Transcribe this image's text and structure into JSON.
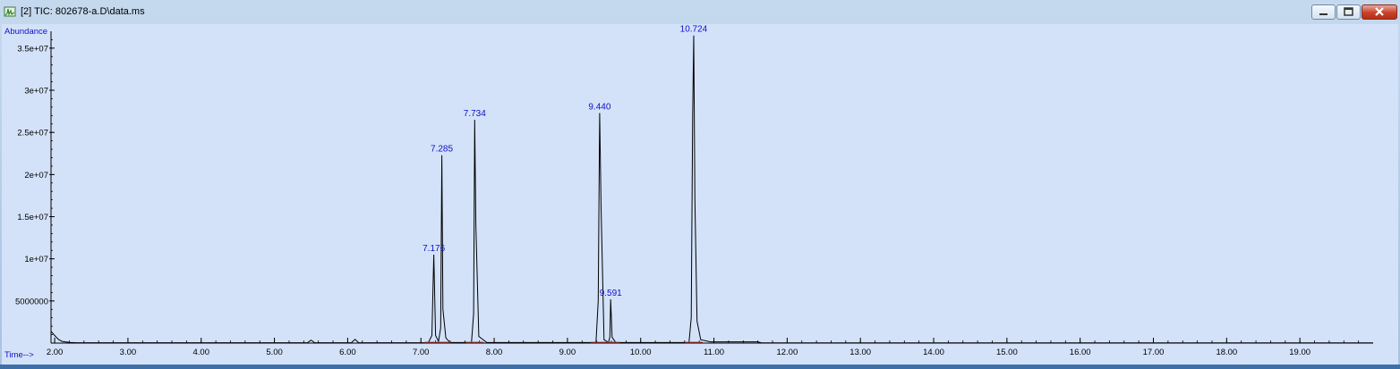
{
  "window": {
    "title": "[2] TIC: 802678-a.D\\data.ms",
    "icon": "chromatogram-app-icon",
    "controls": [
      "minimize-icon",
      "maximize-icon",
      "close-icon"
    ],
    "colors": {
      "plot_bg": "#d3e2f9",
      "trace": "#000000",
      "peak_label": "#1010c8",
      "baseline_marks": "#d04040"
    }
  },
  "chart_data": {
    "type": "line",
    "title": "",
    "ylabel": "Abundance",
    "xlabel": "Time-->",
    "xlim": [
      1.95,
      20.0
    ],
    "ylim": [
      0,
      37000000
    ],
    "x_ticks": [
      "2.00",
      "3.00",
      "4.00",
      "5.00",
      "6.00",
      "7.00",
      "8.00",
      "9.00",
      "10.00",
      "11.00",
      "12.00",
      "13.00",
      "14.00",
      "15.00",
      "16.00",
      "17.00",
      "18.00",
      "19.00"
    ],
    "y_ticks": [
      "5000000",
      "1e+07",
      "1.5e+07",
      "2e+07",
      "2.5e+07",
      "3e+07",
      "3.5e+07"
    ],
    "grid": false,
    "peaks": [
      {
        "rt": 7.176,
        "label": "7.176",
        "abundance": 10500000
      },
      {
        "rt": 7.285,
        "label": "7.285",
        "abundance": 22300000
      },
      {
        "rt": 7.734,
        "label": "7.734",
        "abundance": 26500000
      },
      {
        "rt": 9.44,
        "label": "9.440",
        "abundance": 27300000
      },
      {
        "rt": 9.591,
        "label": "9.591",
        "abundance": 5200000
      },
      {
        "rt": 10.724,
        "label": "10.724",
        "abundance": 36500000
      }
    ],
    "series": [
      {
        "x": [
          1.95,
          2.0,
          2.05,
          2.1,
          2.2,
          2.3,
          5.45,
          5.5,
          5.55,
          6.05,
          6.1,
          6.15,
          7.1,
          7.15,
          7.176,
          7.2,
          7.24,
          7.27,
          7.285,
          7.3,
          7.34,
          7.4,
          7.69,
          7.72,
          7.734,
          7.75,
          7.79,
          7.9,
          9.39,
          9.42,
          9.44,
          9.46,
          9.5,
          9.56,
          9.58,
          9.591,
          9.61,
          9.66,
          10.66,
          10.69,
          10.71,
          10.724,
          10.74,
          10.77,
          10.82,
          10.95,
          11.6,
          11.65,
          12.0,
          20.0
        ],
        "y": [
          1400000,
          900000,
          450000,
          200000,
          80000,
          40000,
          40000,
          350000,
          40000,
          40000,
          450000,
          40000,
          40000,
          900000,
          10500000,
          900000,
          200000,
          1800000,
          22300000,
          4000000,
          600000,
          60000,
          60000,
          3500000,
          26500000,
          14000000,
          800000,
          60000,
          60000,
          5000000,
          27300000,
          16000000,
          400000,
          80000,
          700000,
          5200000,
          700000,
          60000,
          60000,
          3000000,
          27000000,
          36500000,
          17000000,
          2600000,
          400000,
          150000,
          150000,
          30000,
          20000,
          20000
        ]
      }
    ]
  }
}
